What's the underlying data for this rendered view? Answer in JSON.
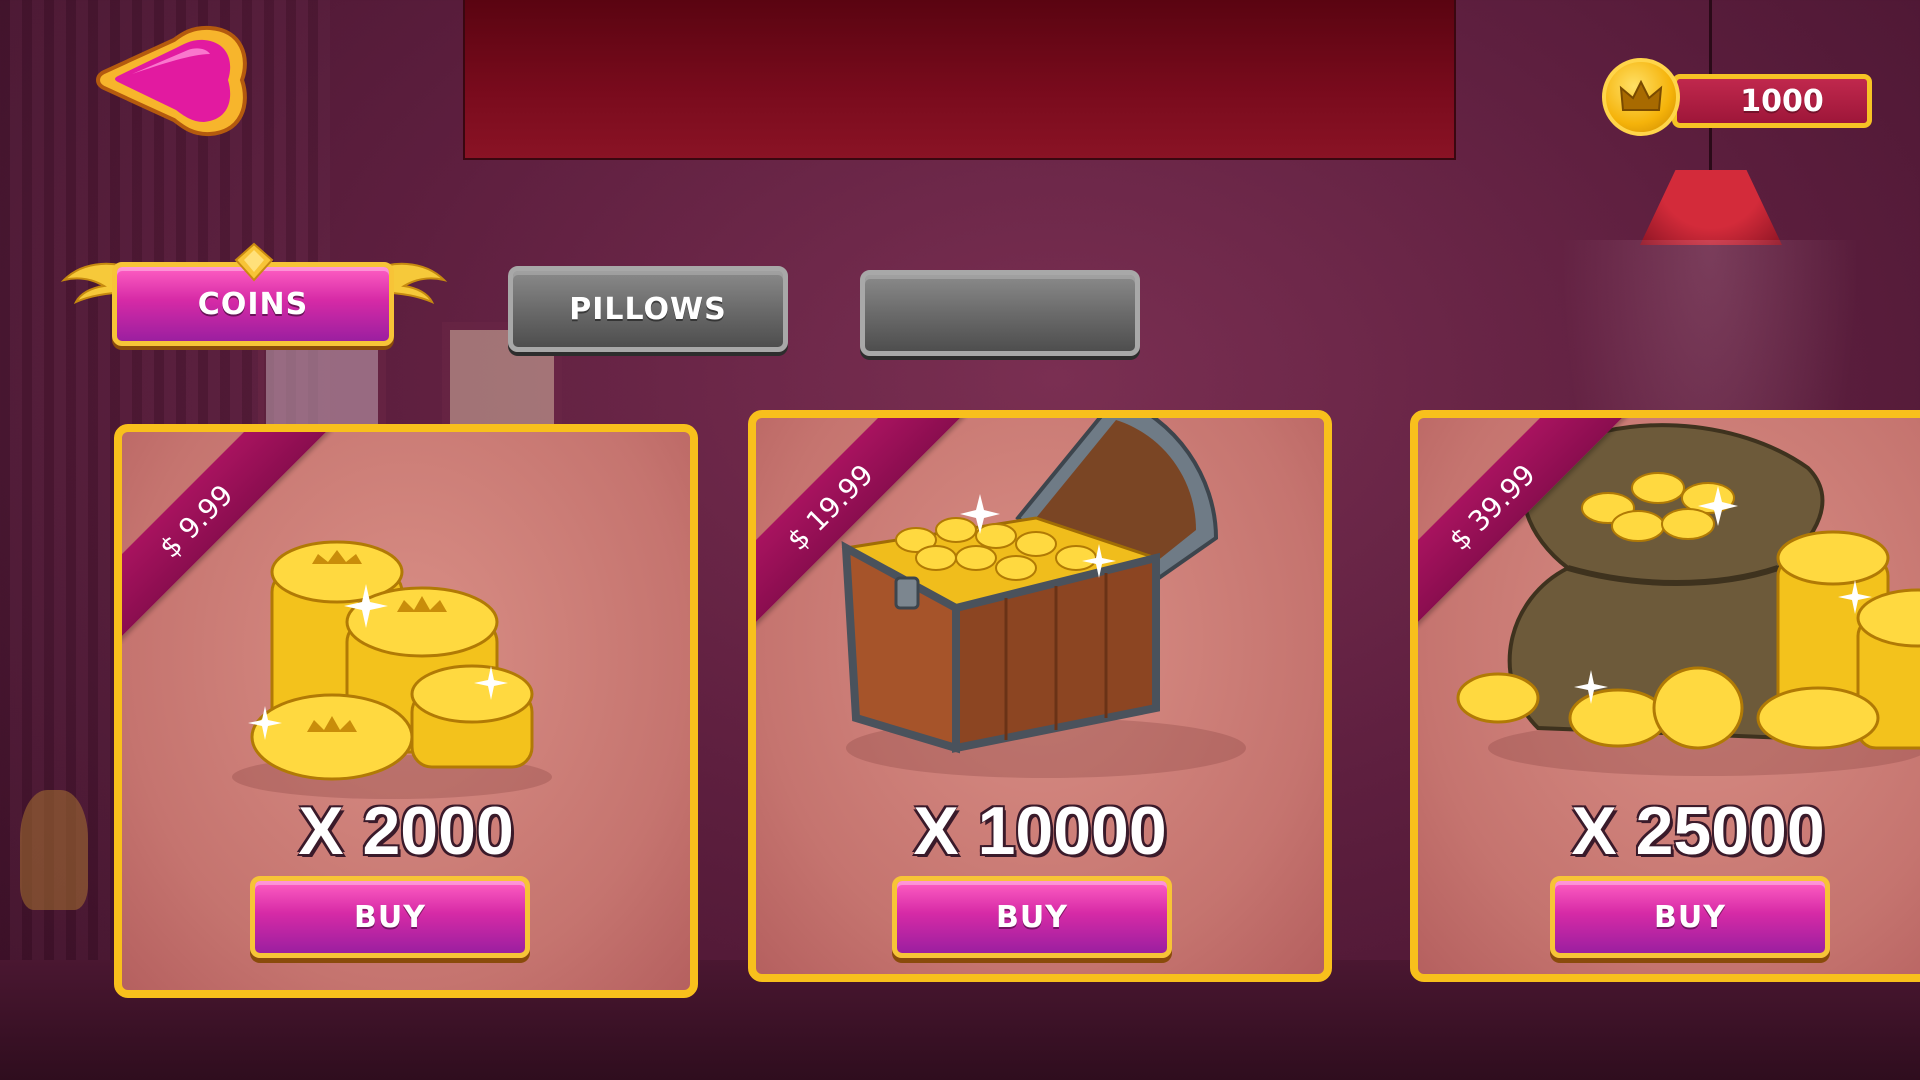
{
  "header": {
    "back_icon": "back-arrow-icon",
    "banner_text": ""
  },
  "balance": {
    "icon": "crown-coin-icon",
    "value": "1000"
  },
  "tabs": [
    {
      "label": "COINS",
      "active": true
    },
    {
      "label": "PILLOWS",
      "active": false
    },
    {
      "label": "",
      "active": false
    }
  ],
  "products": [
    {
      "price": "$ 9.99",
      "amount": "X 2000",
      "buy_label": "BUY",
      "art": "coin-stacks-icon"
    },
    {
      "price": "$ 19.99",
      "amount": "X 10000",
      "buy_label": "BUY",
      "art": "treasure-chest-icon"
    },
    {
      "price": "$ 39.99",
      "amount": "X 25000",
      "buy_label": "BUY",
      "art": "coin-sack-icon"
    }
  ],
  "colors": {
    "accent_gold": "#f8c01c",
    "button_pink": "#d62aa6",
    "ribbon": "#a8135f",
    "card_bg": "#c5746f"
  }
}
